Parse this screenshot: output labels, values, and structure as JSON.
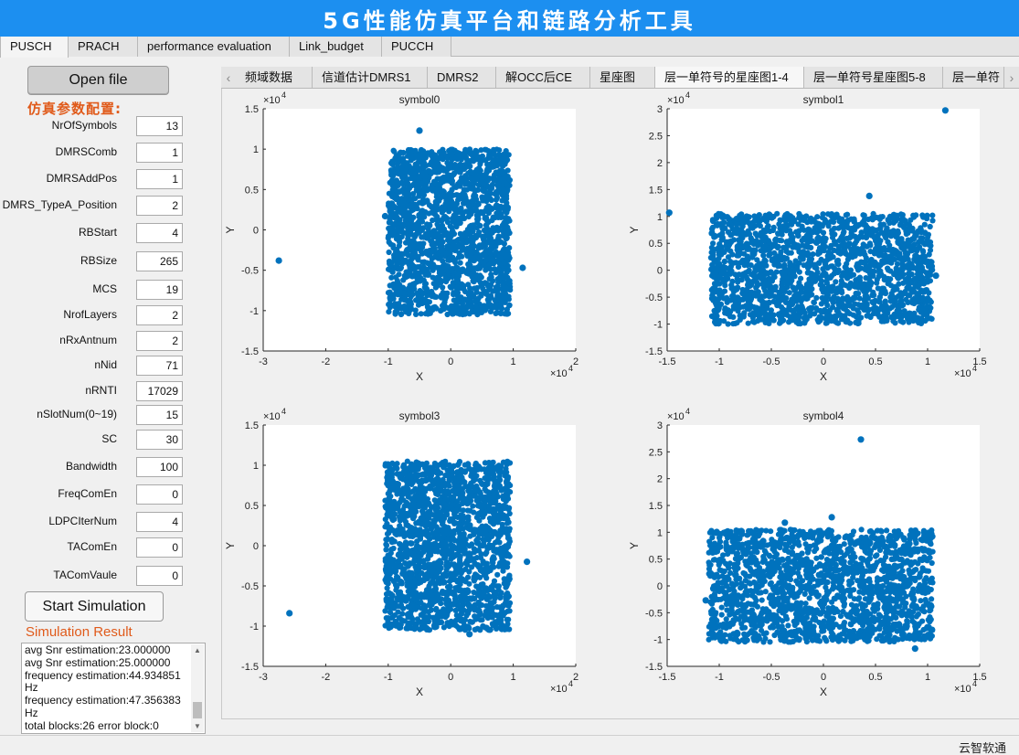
{
  "app": {
    "title": "5G性能仿真平台和链路分析工具",
    "status_text": "云智软通"
  },
  "main_tabs": [
    {
      "label": "PUSCH",
      "active": true
    },
    {
      "label": "PRACH",
      "active": false
    },
    {
      "label": "performance evaluation",
      "active": false
    },
    {
      "label": "Link_budget",
      "active": false
    },
    {
      "label": "PUCCH",
      "active": false
    }
  ],
  "left_panel": {
    "open_file_label": "Open file",
    "config_title": "仿真参数配置:",
    "params": [
      {
        "label": "NrOfSymbols",
        "value": "13"
      },
      {
        "label": "DMRSComb",
        "value": "1"
      },
      {
        "label": "DMRSAddPos",
        "value": "1"
      },
      {
        "label": "DMRS_TypeA_Position",
        "value": "2"
      },
      {
        "label": "RBStart",
        "value": "4"
      },
      {
        "label": "RBSize",
        "value": "265"
      },
      {
        "label": "MCS",
        "value": "19"
      },
      {
        "label": "NrofLayers",
        "value": "2"
      },
      {
        "label": "nRxAntnum",
        "value": "2"
      },
      {
        "label": "nNid",
        "value": "71"
      },
      {
        "label": "nRNTI",
        "value": "17029"
      },
      {
        "label": "nSlotNum(0~19)",
        "value": "15"
      },
      {
        "label": "SC",
        "value": "30"
      },
      {
        "label": "Bandwidth",
        "value": "100"
      },
      {
        "label": "FreqComEn",
        "value": "0"
      },
      {
        "label": "LDPCIterNum",
        "value": "4"
      },
      {
        "label": "TAComEn",
        "value": "0"
      },
      {
        "label": "TAComVaule",
        "value": "0"
      }
    ],
    "start_button_label": "Start Simulation",
    "result_title": "Simulation Result",
    "result_text": "avg Snr estimation:23.000000\navg Snr estimation:25.000000\nfrequency estimation:44.934851\nHz\nfrequency estimation:47.356383\nHz\ntotal blocks:26 error block:0"
  },
  "sub_tabs": [
    {
      "label": "频域数据",
      "active": false
    },
    {
      "label": "信道估计DMRS1",
      "active": false
    },
    {
      "label": "DMRS2",
      "active": false
    },
    {
      "label": "解OCC后CE",
      "active": false
    },
    {
      "label": "星座图",
      "active": false
    },
    {
      "label": "层一单符号的星座图1-4",
      "active": true
    },
    {
      "label": "层一单符号星座图5-8",
      "active": false
    },
    {
      "label": "层一单符",
      "active": false
    }
  ],
  "colors": {
    "title_bar": "#1c8ff0",
    "accent_orange": "#e05a1a",
    "marker": "#0072bd"
  },
  "chart_data": [
    {
      "type": "scatter",
      "title": "symbol0",
      "xlabel": "X",
      "ylabel": "Y",
      "exponent": "×10^4",
      "x_exponent_label": "4",
      "y_exponent_label": "4",
      "xlim": [
        -3,
        2
      ],
      "ylim": [
        -1.5,
        1.5
      ],
      "xticks": [
        "-3",
        "-2",
        "-1",
        "0",
        "1",
        "2"
      ],
      "yticks": [
        "1.5",
        "1",
        "0.5",
        "0",
        "-0.5",
        "-1",
        "-1.5"
      ],
      "cluster": {
        "x_range": [
          -1.0,
          0.95
        ],
        "y_range": [
          -1.05,
          1.0
        ]
      },
      "outliers": [
        [
          -2.75,
          -0.38
        ],
        [
          -0.5,
          1.23
        ],
        [
          1.15,
          -0.47
        ],
        [
          -1.05,
          0.17
        ]
      ]
    },
    {
      "type": "scatter",
      "title": "symbol1",
      "xlabel": "X",
      "ylabel": "Y",
      "exponent": "×10^4",
      "x_exponent_label": "4",
      "y_exponent_label": "4",
      "xlim": [
        -1.5,
        1.5
      ],
      "ylim": [
        -1.5,
        3
      ],
      "xticks": [
        "-1.5",
        "-1",
        "-0.5",
        "0",
        "0.5",
        "1",
        "1.5"
      ],
      "yticks": [
        "3",
        "2.5",
        "2",
        "1.5",
        "1",
        "0.5",
        "0",
        "-0.5",
        "-1",
        "-1.5"
      ],
      "cluster": {
        "x_range": [
          -1.08,
          1.05
        ],
        "y_range": [
          -1.0,
          1.05
        ]
      },
      "outliers": [
        [
          1.17,
          2.97
        ],
        [
          -1.48,
          1.07
        ],
        [
          0.44,
          1.38
        ],
        [
          1.08,
          -0.1
        ]
      ]
    },
    {
      "type": "scatter",
      "title": "symbol3",
      "xlabel": "X",
      "ylabel": "Y",
      "exponent": "×10^4",
      "x_exponent_label": "4",
      "y_exponent_label": "4",
      "xlim": [
        -3,
        2
      ],
      "ylim": [
        -1.5,
        1.5
      ],
      "xticks": [
        "-3",
        "-2",
        "-1",
        "0",
        "1",
        "2"
      ],
      "yticks": [
        "1.5",
        "1",
        "0.5",
        "0",
        "-0.5",
        "-1",
        "-1.5"
      ],
      "cluster": {
        "x_range": [
          -1.05,
          0.95
        ],
        "y_range": [
          -1.05,
          1.05
        ]
      },
      "outliers": [
        [
          -2.58,
          -0.84
        ],
        [
          1.22,
          -0.2
        ],
        [
          0.3,
          -1.1
        ]
      ]
    },
    {
      "type": "scatter",
      "title": "symbol4",
      "xlabel": "X",
      "ylabel": "Y",
      "exponent": "×10^4",
      "x_exponent_label": "4",
      "y_exponent_label": "4",
      "xlim": [
        -1.5,
        1.5
      ],
      "ylim": [
        -1.5,
        3
      ],
      "xticks": [
        "-1.5",
        "-1",
        "-0.5",
        "0",
        "0.5",
        "1",
        "1.5"
      ],
      "yticks": [
        "3",
        "2.5",
        "2",
        "1.5",
        "1",
        "0.5",
        "0",
        "-0.5",
        "-1",
        "-1.5"
      ],
      "cluster": {
        "x_range": [
          -1.1,
          1.05
        ],
        "y_range": [
          -1.05,
          1.05
        ]
      },
      "outliers": [
        [
          0.36,
          2.73
        ],
        [
          -1.13,
          -0.27
        ],
        [
          0.08,
          1.28
        ],
        [
          -0.37,
          1.18
        ],
        [
          0.88,
          -1.17
        ]
      ]
    }
  ]
}
